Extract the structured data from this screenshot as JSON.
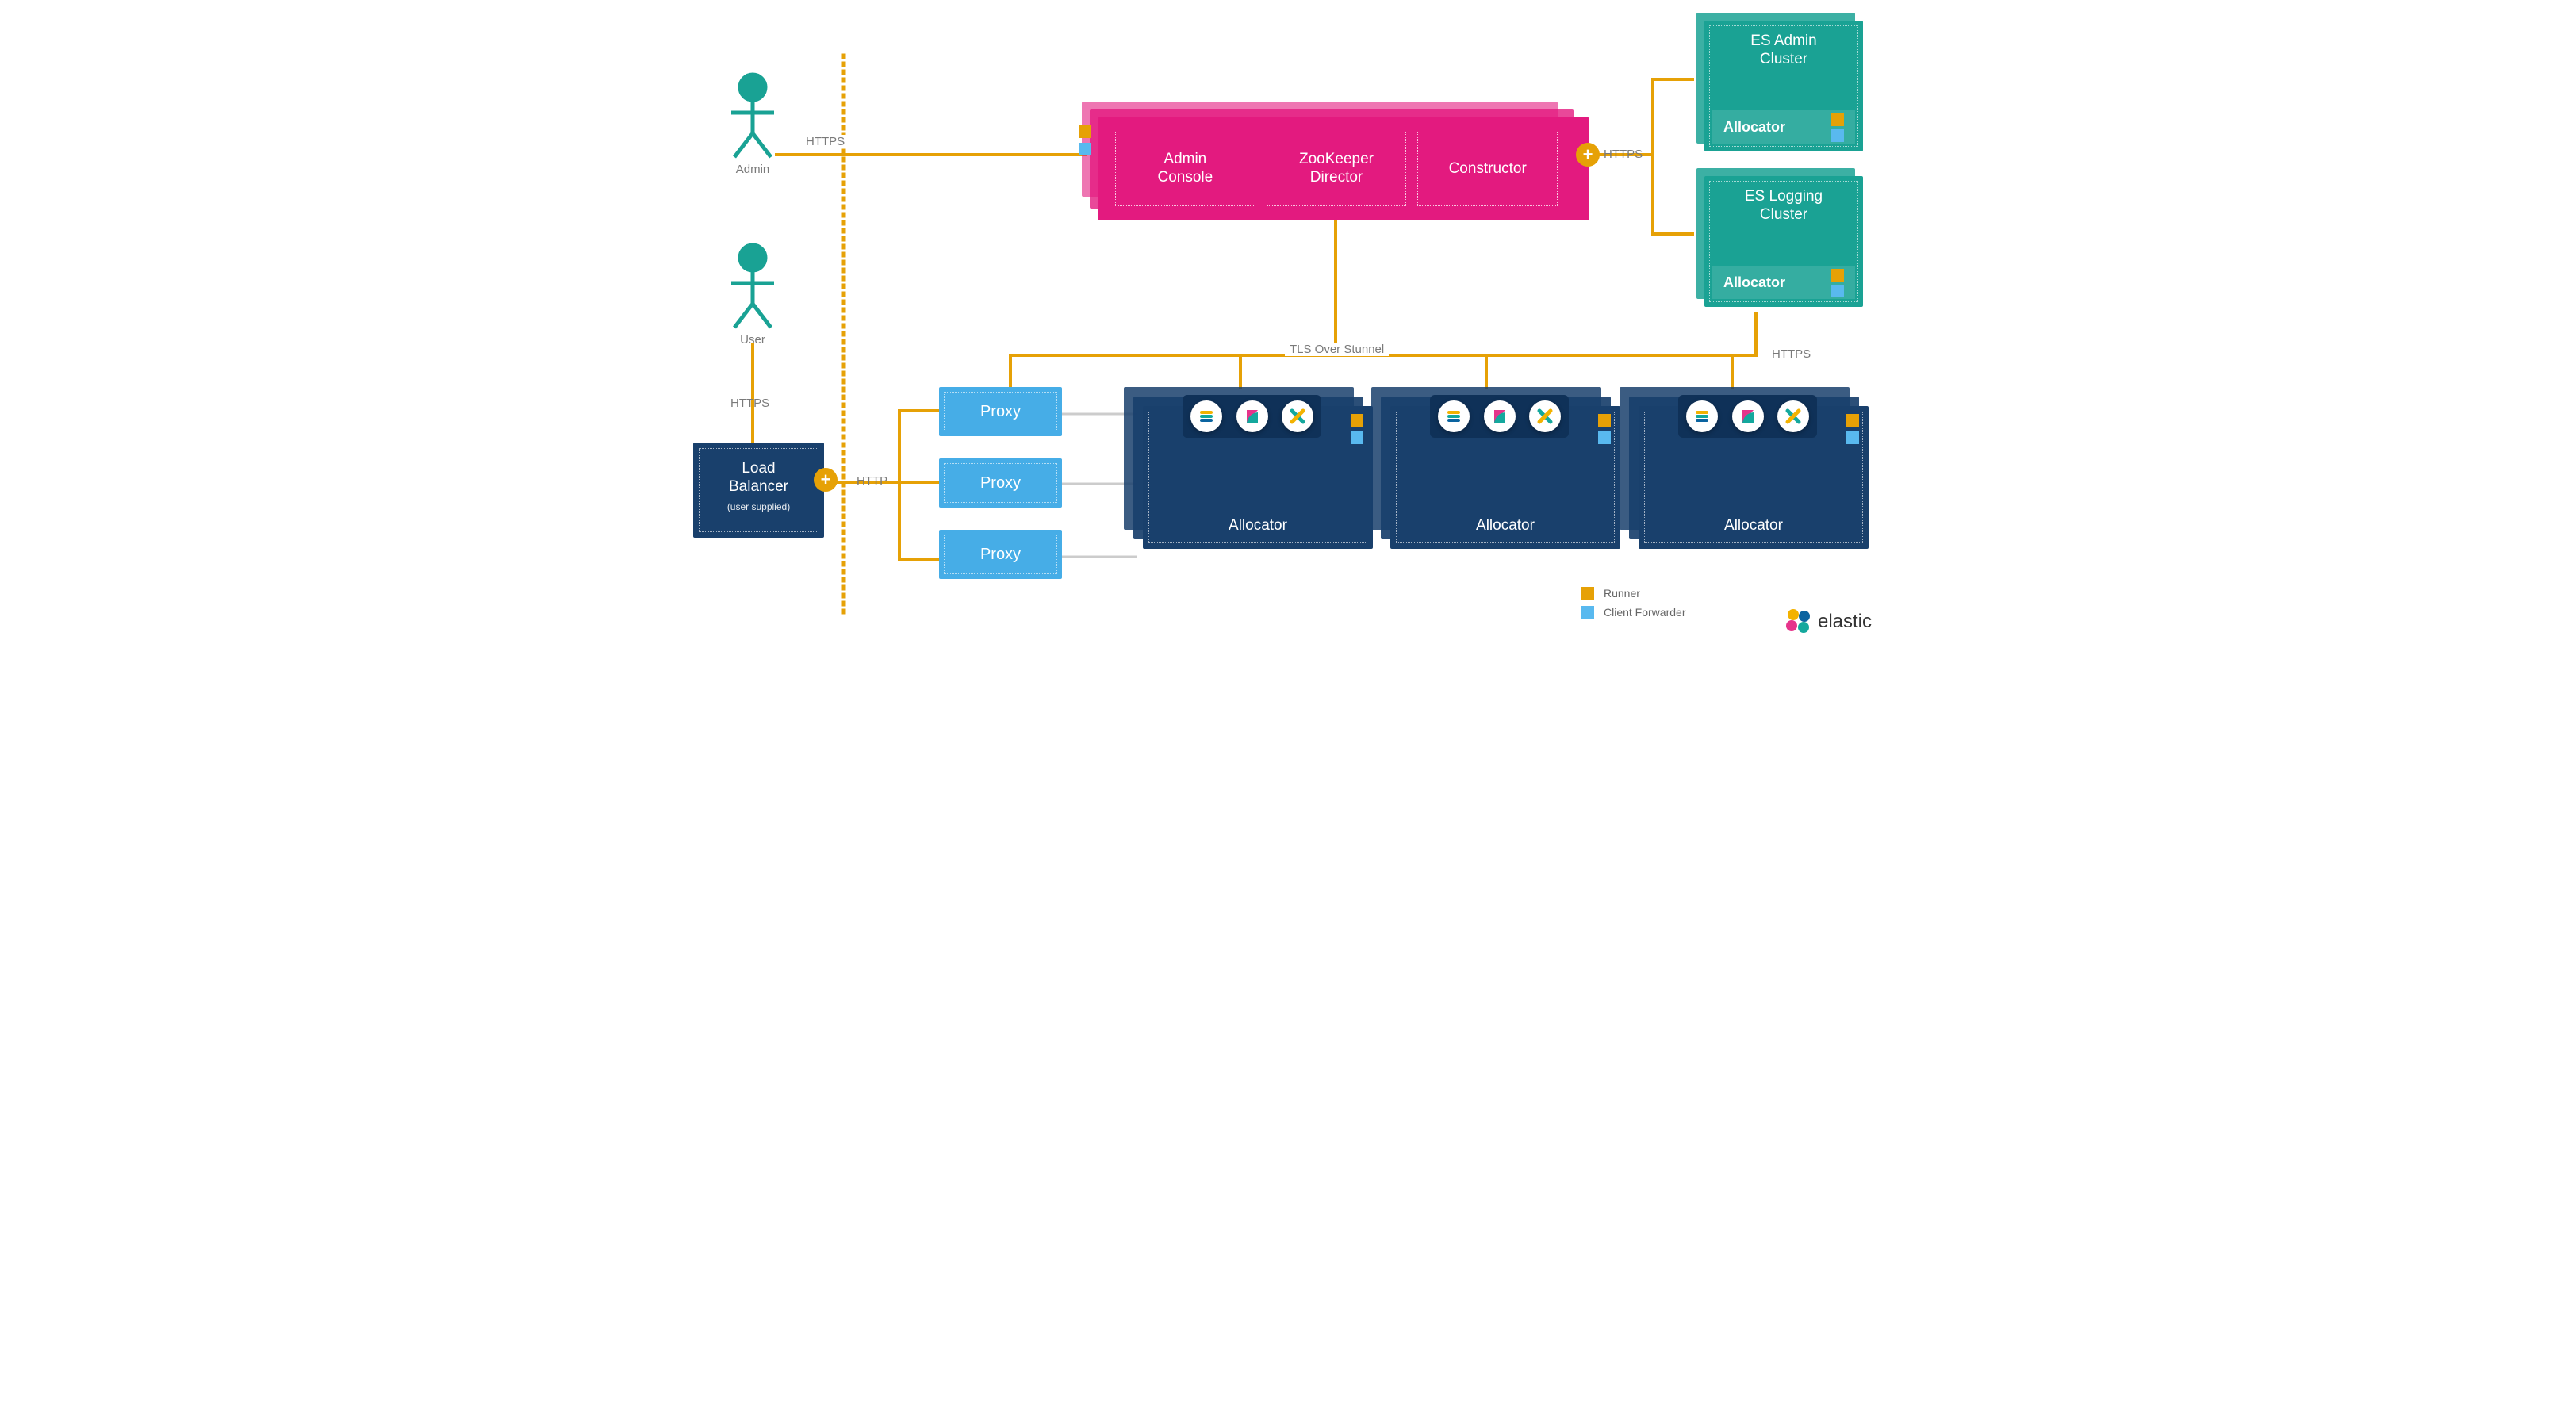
{
  "actors": {
    "admin": "Admin",
    "user": "User"
  },
  "lb": {
    "title_l1": "Load",
    "title_l2": "Balancer",
    "sub": "(user supplied)"
  },
  "proxies": [
    "Proxy",
    "Proxy",
    "Proxy"
  ],
  "protocols": {
    "admin_to_ctrl": "HTTPS",
    "user_to_lb": "HTTPS",
    "lb_to_proxy": "HTTP",
    "tls_bus": "TLS Over Stunnel",
    "ctrl_to_clusters": "HTTPS",
    "clusters_to_alloc": "HTTPS"
  },
  "control_plane": {
    "admin_console_l1": "Admin",
    "admin_console_l2": "Console",
    "zk_l1": "ZooKeeper",
    "zk_l2": "Director",
    "constructor": "Constructor"
  },
  "allocators": [
    "Allocator",
    "Allocator",
    "Allocator"
  ],
  "clusters": {
    "admin": {
      "l1": "ES Admin",
      "l2": "Cluster",
      "alloc": "Allocator"
    },
    "logging": {
      "l1": "ES Logging",
      "l2": "Cluster",
      "alloc": "Allocator"
    }
  },
  "legend": {
    "runner": "Runner",
    "forwarder": "Client Forwarder"
  },
  "brand": "elastic",
  "colors": {
    "gold": "#e6a106",
    "magenta": "#e31a7f",
    "darkblue": "#19406c",
    "teal": "#1aa294",
    "sky": "#46ade7",
    "grey": "#7a7a7a"
  }
}
